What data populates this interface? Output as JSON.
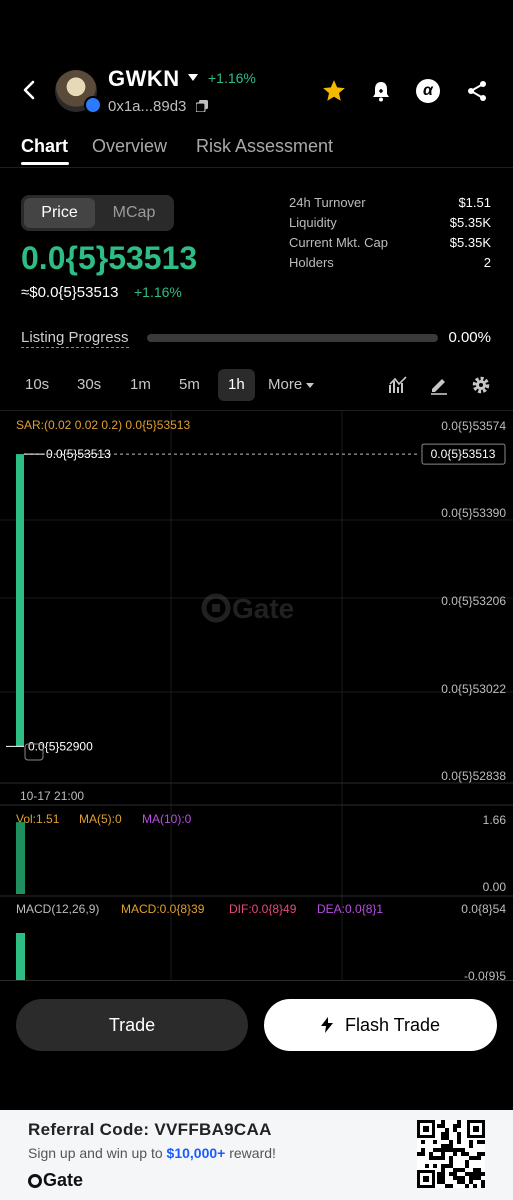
{
  "header": {
    "token_name": "GWKN",
    "change": "+1.16%",
    "address": "0x1a...89d3"
  },
  "tabs": [
    "Chart",
    "Overview",
    "Risk Assessment"
  ],
  "price_toggle": {
    "price": "Price",
    "mcap": "MCap"
  },
  "price": {
    "main": "0.0{5}53513",
    "usd": "≈$0.0{5}53513",
    "change": "+1.16%"
  },
  "stats": [
    {
      "label": "24h Turnover",
      "value": "$1.51"
    },
    {
      "label": "Liquidity",
      "value": "$5.35K"
    },
    {
      "label": "Current Mkt. Cap",
      "value": "$5.35K"
    },
    {
      "label": "Holders",
      "value": "2"
    }
  ],
  "listing": {
    "label": "Listing Progress",
    "value": "0.00%",
    "fraction": 0.0
  },
  "intervals": [
    "10s",
    "30s",
    "1m",
    "5m",
    "1h"
  ],
  "more_label": "More",
  "chart": {
    "indicator": "SAR:(0.02 0.02 0.2) 0.0{5}53513",
    "price_ticks": [
      "0.0{5}53574",
      "0.0{5}53390",
      "0.0{5}53206",
      "0.0{5}53022",
      "0.0{5}52838"
    ],
    "current_price_tag": "0.0{5}53513",
    "high_label": "0.0{5}53513",
    "low_label": "0.0{5}52900",
    "time_label": "10-17 21:00",
    "watermark": "Gate",
    "vol_label": "Vol:1.51",
    "ma5_label": "MA(5):0",
    "ma10_label": "MA(10):0",
    "vol_top": "1.66",
    "vol_bottom": "0.00",
    "macd_label": "MACD(12,26,9)",
    "macd_value": "MACD:0.0{8}39",
    "dif_value": "DIF:0.0{8}49",
    "dea_value": "DEA:0.0{8}1",
    "macd_top": "0.0{8}54",
    "macd_bottom": "-0.0{9}5"
  },
  "chart_data": {
    "type": "bar",
    "candles": [
      {
        "time": "10-17 21:00",
        "open": 5.29e-06,
        "high": 5.3513e-06,
        "low": 5.29e-06,
        "close": 5.3513e-06
      }
    ],
    "volume": [
      1.51
    ],
    "price_ylim": [
      5.2838e-06,
      5.3574e-06
    ],
    "volume_ylim": [
      0.0,
      1.66
    ]
  },
  "buttons": {
    "trade": "Trade",
    "flash_trade": "Flash Trade"
  },
  "footer": {
    "ref_code": "Referral Code: VVFFBA9CAA",
    "ref_text_before": "Sign up and win up to ",
    "ref_amount": "$10,000+",
    "ref_text_after": " reward!",
    "brand": "Gate"
  },
  "colors": {
    "accent_green": "#2ebd85",
    "sar_orange": "#e0a030",
    "ma10_purple": "#b84ee0",
    "dif_pink": "#e84a7a"
  }
}
